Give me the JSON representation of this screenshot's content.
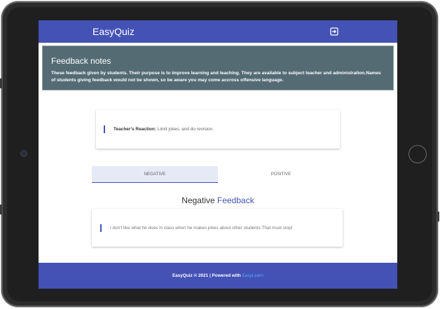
{
  "app": {
    "brand": "EasyQuiz"
  },
  "notes": {
    "title": "Feedback notes",
    "text": "These feedback given by students. Their purpose is to improve learning and teaching. They are available to subject teacher and administration.Names of students giving feedback would not be shown, so be aware you may come accross offensive language."
  },
  "reaction": {
    "label": "Teacher's Reaction:",
    "text": " Limit jokes, and do revision."
  },
  "tabs": [
    {
      "label": "NEGATIVE"
    },
    {
      "label": "POSITIVE"
    }
  ],
  "heading": {
    "part1": "Negative ",
    "part2": "Feedback"
  },
  "feedback": {
    "text": "I don't like what he does in class when he makes jokes about other students.That must stop!"
  },
  "footer": {
    "text": "EasyQuiz © 2021 | Powered with ",
    "link": "EasyLearn"
  },
  "colors": {
    "primary": "#4452b5",
    "notes_bg": "#546b74",
    "link": "#5aa6ff",
    "frame": "#2c2c2c"
  },
  "icons": {
    "logout": "logout-icon"
  }
}
